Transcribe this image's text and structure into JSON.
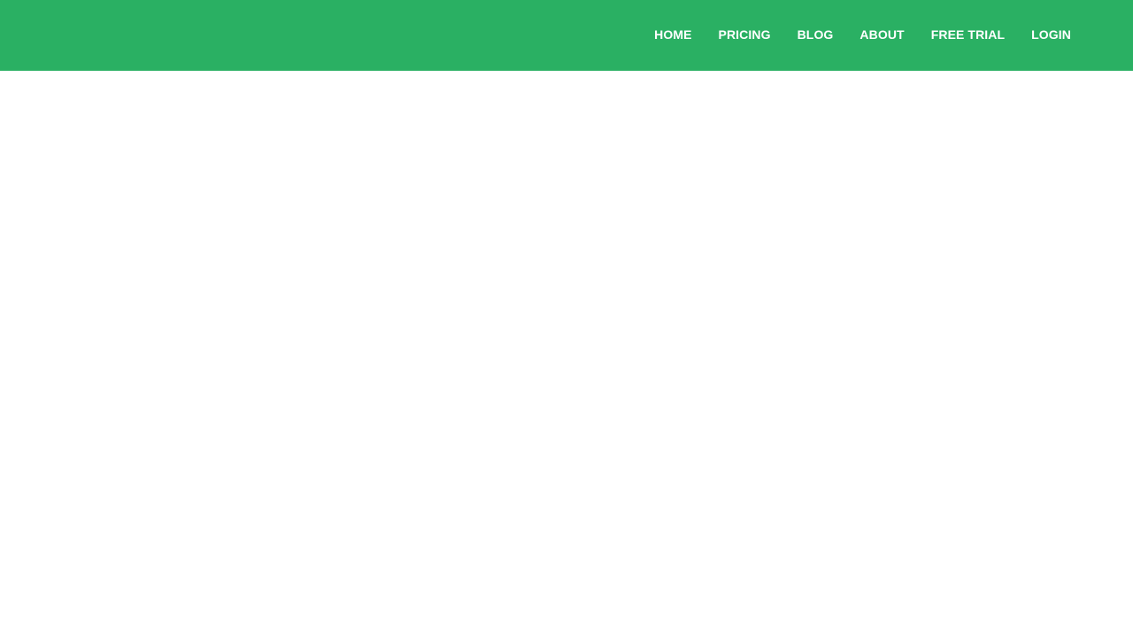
{
  "header": {
    "background_color": "#2ab063",
    "nav": [
      {
        "label": "HOME"
      },
      {
        "label": "PRICING"
      },
      {
        "label": "BLOG"
      },
      {
        "label": "ABOUT"
      },
      {
        "label": "FREE TRIAL"
      },
      {
        "label": "LOGIN"
      }
    ]
  }
}
